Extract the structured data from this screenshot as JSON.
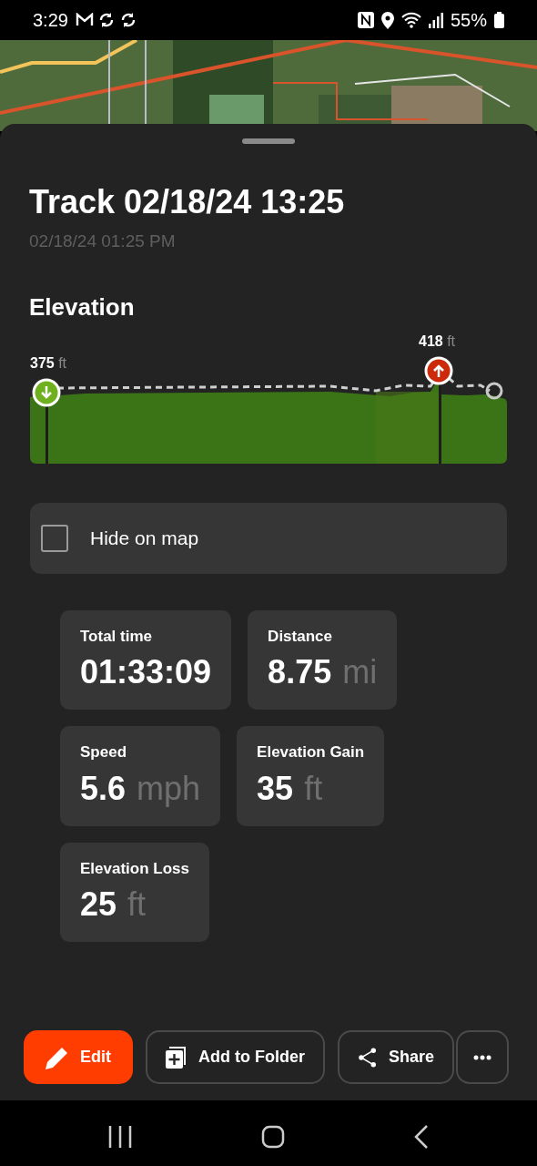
{
  "status_bar": {
    "time": "3:29",
    "battery": "55%"
  },
  "map": {
    "kind": "picture"
  },
  "track": {
    "title": "Track 02/18/24 13:25",
    "subtitle": "02/18/24 01:25 PM"
  },
  "elevation": {
    "heading": "Elevation",
    "low": {
      "value": "375",
      "unit": "ft"
    },
    "high": {
      "value": "418",
      "unit": "ft"
    }
  },
  "hide_on_map": {
    "label": "Hide on map",
    "checked": false
  },
  "stat_rows": [
    [
      {
        "label": "Total time",
        "value": "01:33:09"
      },
      {
        "label": "Distance",
        "value": "8.75",
        "unit": "mi"
      }
    ],
    [
      {
        "label": "Speed",
        "value": "5.6",
        "unit": "mph"
      },
      {
        "label": "Elevation Gain",
        "value": "35",
        "unit": "ft"
      }
    ],
    [
      {
        "label": "Elevation Loss",
        "value": "25",
        "unit": "ft"
      }
    ]
  ],
  "actions": [
    {
      "kind": "edit",
      "label": "Edit"
    },
    {
      "kind": "folder",
      "label": "Add to Folder"
    },
    {
      "kind": "share",
      "label": "Share"
    },
    {
      "kind": "more"
    }
  ]
}
